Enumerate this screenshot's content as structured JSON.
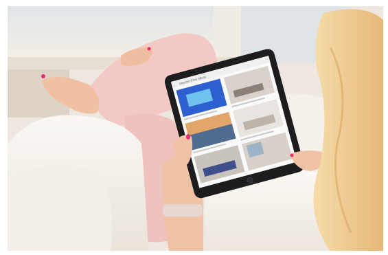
{
  "tablet": {
    "header_text": "Interior Pins Ideas"
  },
  "colors": {
    "wall": "#efe9e2",
    "window_light": "#e3e9ec",
    "blanket": "#f6f3ee",
    "pants": "#f2c9c4",
    "skin": "#f1c3a6",
    "hair": "#eec98e",
    "tablet_body": "#1d1d20",
    "nail_polish": "#e0316a",
    "watch_band": "#e9d7d2"
  },
  "icons": [
    "back-arrow-icon",
    "home-button-icon"
  ]
}
